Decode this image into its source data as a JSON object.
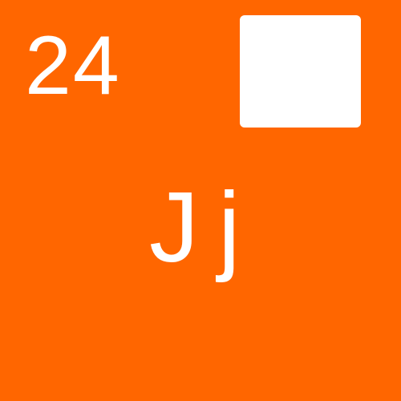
{
  "tile": {
    "number": "24",
    "letters": "Jj",
    "background_color": "#FF6600",
    "foreground_color": "#FFFFFF"
  }
}
